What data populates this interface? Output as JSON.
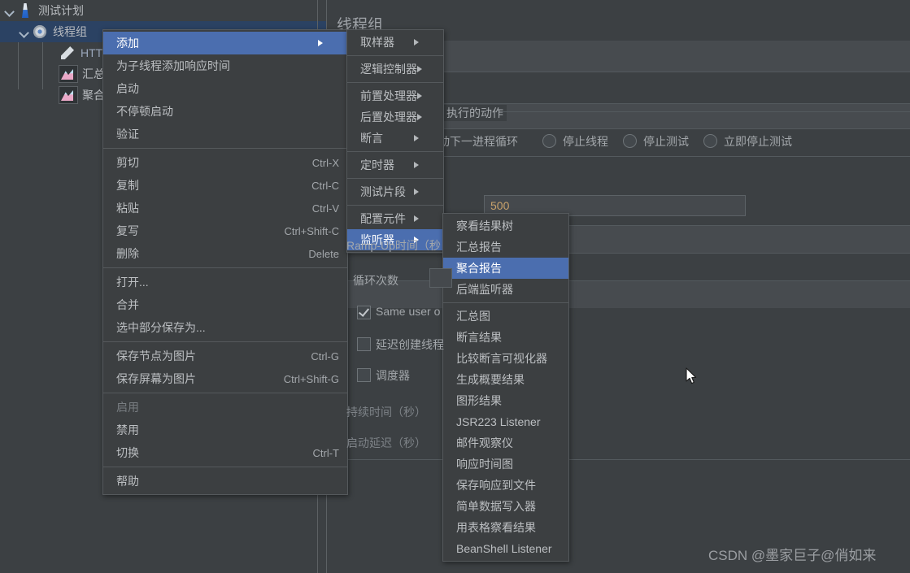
{
  "app": {
    "theme_bg": "#3c4043",
    "menu_bg": "#3c3f41",
    "highlight": "#4b6eaf",
    "selection": "#2b4263",
    "value_color": "#c8a26b"
  },
  "tree": {
    "items": [
      {
        "label": "测试计划",
        "icon": "flask-icon",
        "depth": 0,
        "expanded": true,
        "selected": false
      },
      {
        "label": "线程组",
        "icon": "gear-icon",
        "depth": 1,
        "expanded": true,
        "selected": true
      },
      {
        "label": "HTT",
        "icon": "pipette-icon",
        "depth": 2,
        "expanded": false,
        "selected": false
      },
      {
        "label": "汇总",
        "icon": "chart-icon",
        "depth": 2,
        "expanded": false,
        "selected": false
      },
      {
        "label": "聚合",
        "icon": "chart-icon",
        "depth": 2,
        "expanded": false,
        "selected": false
      }
    ]
  },
  "panel": {
    "title": "线程组",
    "action_group_legend": "执行的动作",
    "radio_continue_label": "动下一进程循环",
    "radios": [
      {
        "label": "停止线程",
        "selected": false
      },
      {
        "label": "停止测试",
        "selected": false
      },
      {
        "label": "立即停止测试",
        "selected": false
      }
    ],
    "thread_count_value": "500",
    "ramp_up_label": "Ramp-Up时间（秒",
    "loop_count_label": "循环次数",
    "checkboxes": [
      {
        "label": "Same user o",
        "checked": true
      },
      {
        "label": "延迟创建线程",
        "checked": false
      },
      {
        "label": "调度器",
        "checked": false
      }
    ],
    "duration_label": "持续时间（秒）",
    "startup_delay_label": "启动延迟（秒）"
  },
  "context_menu": {
    "items": [
      {
        "label": "添加",
        "submenu": true,
        "highlighted": true,
        "accel": "",
        "disabled": false
      },
      {
        "label": "为子线程添加响应时间",
        "submenu": false,
        "accel": "",
        "disabled": false
      },
      {
        "label": "启动",
        "submenu": false,
        "accel": "",
        "disabled": false
      },
      {
        "label": "不停顿启动",
        "submenu": false,
        "accel": "",
        "disabled": false
      },
      {
        "label": "验证",
        "submenu": false,
        "accel": "",
        "disabled": false
      },
      {
        "separator": true
      },
      {
        "label": "剪切",
        "submenu": false,
        "accel": "Ctrl-X",
        "disabled": false
      },
      {
        "label": "复制",
        "submenu": false,
        "accel": "Ctrl-C",
        "disabled": false
      },
      {
        "label": "粘贴",
        "submenu": false,
        "accel": "Ctrl-V",
        "disabled": false
      },
      {
        "label": "复写",
        "submenu": false,
        "accel": "Ctrl+Shift-C",
        "disabled": false
      },
      {
        "label": "删除",
        "submenu": false,
        "accel": "Delete",
        "disabled": false
      },
      {
        "separator": true
      },
      {
        "label": "打开...",
        "submenu": false,
        "accel": "",
        "disabled": false
      },
      {
        "label": "合并",
        "submenu": false,
        "accel": "",
        "disabled": false
      },
      {
        "label": "选中部分保存为...",
        "submenu": false,
        "accel": "",
        "disabled": false
      },
      {
        "separator": true
      },
      {
        "label": "保存节点为图片",
        "submenu": false,
        "accel": "Ctrl-G",
        "disabled": false
      },
      {
        "label": "保存屏幕为图片",
        "submenu": false,
        "accel": "Ctrl+Shift-G",
        "disabled": false
      },
      {
        "separator": true
      },
      {
        "label": "启用",
        "submenu": false,
        "accel": "",
        "disabled": true
      },
      {
        "label": "禁用",
        "submenu": false,
        "accel": "",
        "disabled": false
      },
      {
        "label": "切换",
        "submenu": false,
        "accel": "Ctrl-T",
        "disabled": false
      },
      {
        "separator": true
      },
      {
        "label": "帮助",
        "submenu": false,
        "accel": "",
        "disabled": false
      }
    ]
  },
  "add_menu": {
    "items": [
      {
        "label": "取样器",
        "submenu": true,
        "highlighted": false
      },
      {
        "separator": true
      },
      {
        "label": "逻辑控制器",
        "submenu": true,
        "highlighted": false
      },
      {
        "separator": true
      },
      {
        "label": "前置处理器",
        "submenu": true,
        "highlighted": false
      },
      {
        "label": "后置处理器",
        "submenu": true,
        "highlighted": false
      },
      {
        "label": "断言",
        "submenu": true,
        "highlighted": false
      },
      {
        "separator": true
      },
      {
        "label": "定时器",
        "submenu": true,
        "highlighted": false
      },
      {
        "separator": true
      },
      {
        "label": "测试片段",
        "submenu": true,
        "highlighted": false
      },
      {
        "separator": true
      },
      {
        "label": "配置元件",
        "submenu": true,
        "highlighted": false
      },
      {
        "label": "监听器",
        "submenu": true,
        "highlighted": true
      }
    ]
  },
  "listener_menu": {
    "items": [
      {
        "label": "察看结果树",
        "highlighted": false
      },
      {
        "label": "汇总报告",
        "highlighted": false
      },
      {
        "label": "聚合报告",
        "highlighted": true
      },
      {
        "label": "后端监听器",
        "highlighted": false
      },
      {
        "separator": true
      },
      {
        "label": "汇总图",
        "highlighted": false
      },
      {
        "label": "断言结果",
        "highlighted": false
      },
      {
        "label": "比较断言可视化器",
        "highlighted": false
      },
      {
        "label": "生成概要结果",
        "highlighted": false
      },
      {
        "label": "图形结果",
        "highlighted": false
      },
      {
        "label": "JSR223 Listener",
        "highlighted": false
      },
      {
        "label": "邮件观察仪",
        "highlighted": false
      },
      {
        "label": "响应时间图",
        "highlighted": false
      },
      {
        "label": "保存响应到文件",
        "highlighted": false
      },
      {
        "label": "简单数据写入器",
        "highlighted": false
      },
      {
        "label": "用表格察看结果",
        "highlighted": false
      },
      {
        "label": "BeanShell Listener",
        "highlighted": false
      }
    ]
  },
  "watermark": {
    "text": "CSDN @墨家巨子@俏如来"
  }
}
